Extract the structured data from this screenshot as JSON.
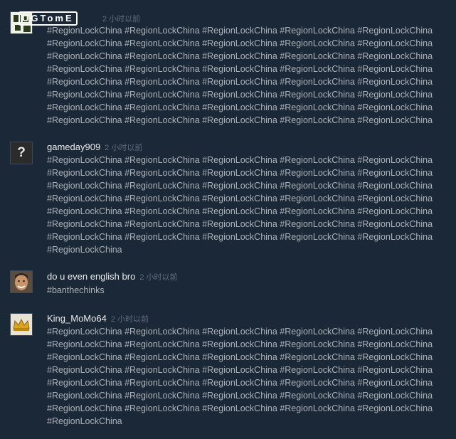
{
  "watermark": "UGTomE",
  "comments": [
    {
      "author": "",
      "time": "2 小时以前",
      "avatar": "logo-avatar",
      "text": "#RegionLockChina #RegionLockChina #RegionLockChina #RegionLockChina #RegionLockChina\n#RegionLockChina #RegionLockChina #RegionLockChina #RegionLockChina #RegionLockChina\n#RegionLockChina #RegionLockChina #RegionLockChina #RegionLockChina #RegionLockChina\n#RegionLockChina #RegionLockChina #RegionLockChina #RegionLockChina #RegionLockChina\n#RegionLockChina #RegionLockChina #RegionLockChina #RegionLockChina #RegionLockChina\n#RegionLockChina #RegionLockChina #RegionLockChina #RegionLockChina #RegionLockChina\n#RegionLockChina #RegionLockChina #RegionLockChina #RegionLockChina #RegionLockChina\n#RegionLockChina #RegionLockChina #RegionLockChina #RegionLockChina #RegionLockChina"
    },
    {
      "author": "gameday909",
      "time": "2 小时以前",
      "avatar": "question-mark-avatar",
      "text": "#RegionLockChina #RegionLockChina #RegionLockChina #RegionLockChina #RegionLockChina\n#RegionLockChina #RegionLockChina #RegionLockChina #RegionLockChina #RegionLockChina\n#RegionLockChina #RegionLockChina #RegionLockChina #RegionLockChina #RegionLockChina\n#RegionLockChina #RegionLockChina #RegionLockChina #RegionLockChina #RegionLockChina\n#RegionLockChina #RegionLockChina #RegionLockChina #RegionLockChina #RegionLockChina\n#RegionLockChina #RegionLockChina #RegionLockChina #RegionLockChina #RegionLockChina\n#RegionLockChina #RegionLockChina #RegionLockChina #RegionLockChina #RegionLockChina\n#RegionLockChina"
    },
    {
      "author": "do u even english bro",
      "time": "2 小时以前",
      "avatar": "face-avatar",
      "text": "#banthechinks"
    },
    {
      "author": "King_MoMo64",
      "time": "2 小时以前",
      "avatar": "crown-avatar",
      "text": "#RegionLockChina #RegionLockChina #RegionLockChina #RegionLockChina #RegionLockChina\n#RegionLockChina #RegionLockChina #RegionLockChina #RegionLockChina #RegionLockChina\n#RegionLockChina #RegionLockChina #RegionLockChina #RegionLockChina #RegionLockChina\n#RegionLockChina #RegionLockChina #RegionLockChina #RegionLockChina #RegionLockChina\n#RegionLockChina #RegionLockChina #RegionLockChina #RegionLockChina #RegionLockChina\n#RegionLockChina #RegionLockChina #RegionLockChina #RegionLockChina #RegionLockChina\n#RegionLockChina #RegionLockChina #RegionLockChina #RegionLockChina #RegionLockChina\n#RegionLockChina"
    }
  ]
}
